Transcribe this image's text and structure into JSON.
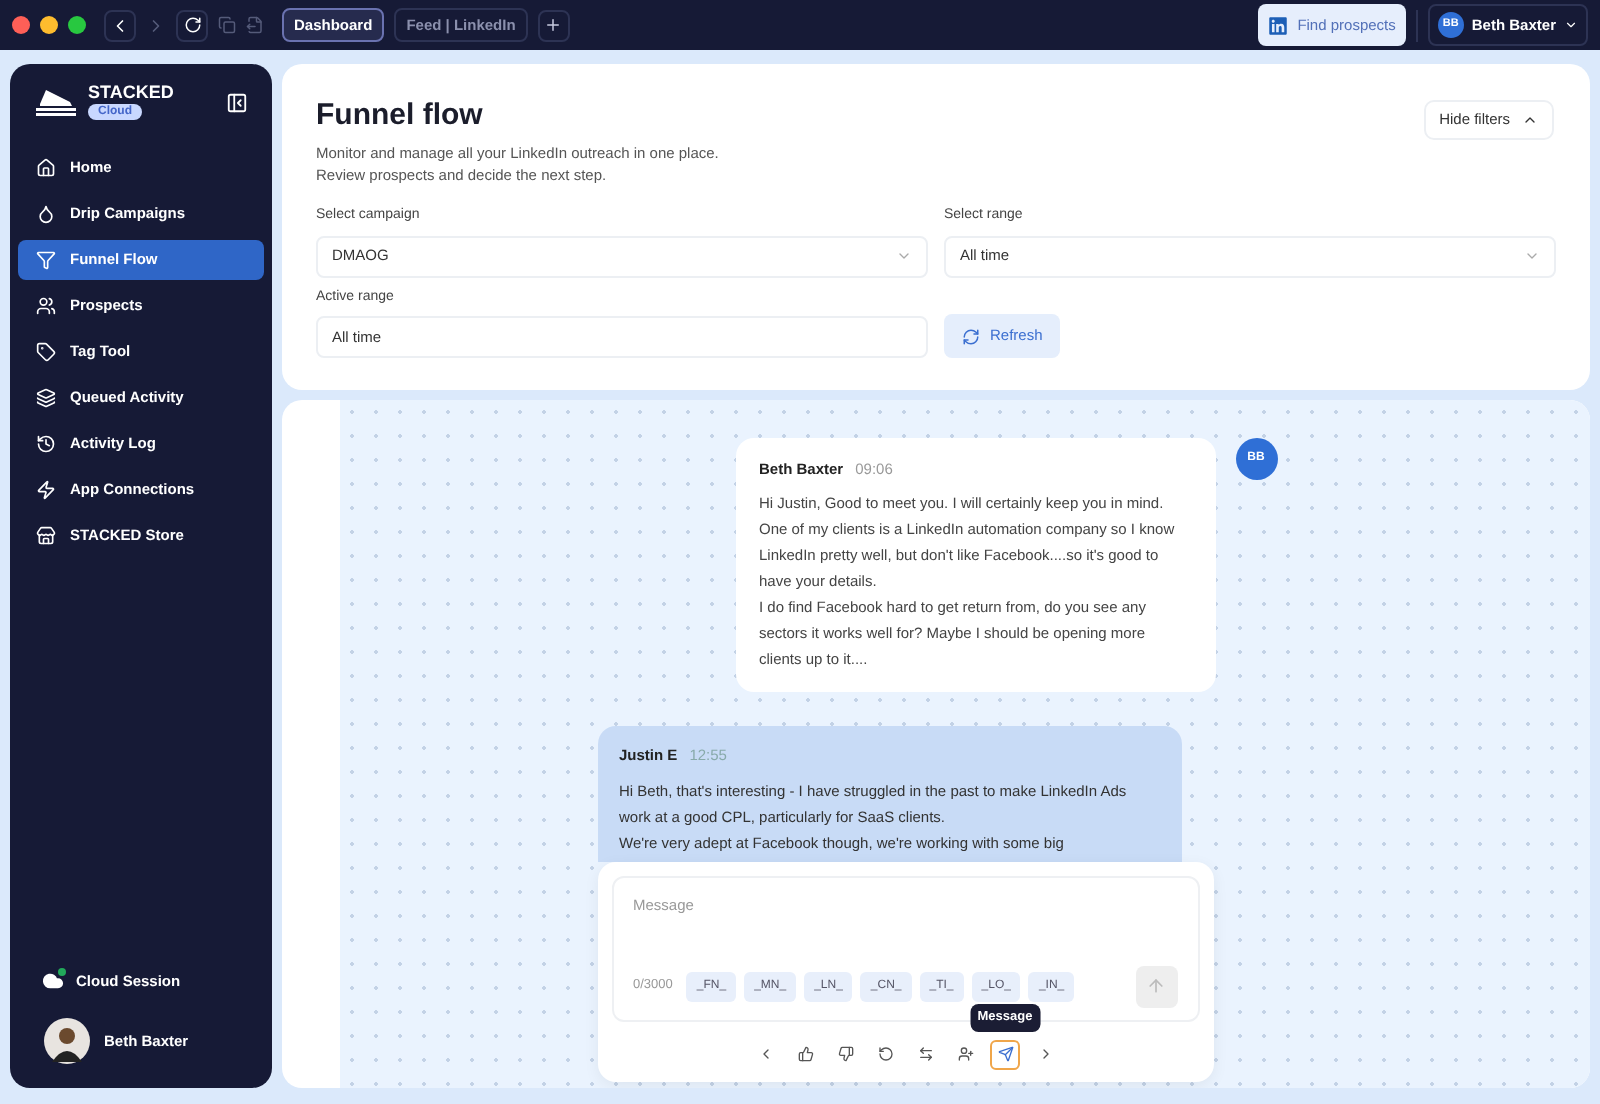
{
  "browser": {
    "tabs": [
      {
        "label": "Dashboard",
        "selected": true
      },
      {
        "label": "Feed | LinkedIn",
        "selected": false
      }
    ],
    "find_prospects": "Find prospects",
    "user_initials": "BB",
    "user_name": "Beth Baxter"
  },
  "sidebar": {
    "brand": "STACKED",
    "badge": "Cloud",
    "items": [
      {
        "label": "Home",
        "kind": "home",
        "selected": false
      },
      {
        "label": "Drip Campaigns",
        "kind": "drip",
        "selected": false
      },
      {
        "label": "Funnel Flow",
        "kind": "funnel",
        "selected": true
      },
      {
        "label": "Prospects",
        "kind": "users",
        "selected": false
      },
      {
        "label": "Tag Tool",
        "kind": "tag",
        "selected": false
      },
      {
        "label": "Queued Activity",
        "kind": "layers",
        "selected": false
      },
      {
        "label": "Activity Log",
        "kind": "history",
        "selected": false
      },
      {
        "label": "App Connections",
        "kind": "zap",
        "selected": false
      },
      {
        "label": "STACKED Store",
        "kind": "store",
        "selected": false
      }
    ],
    "session_label": "Cloud Session",
    "user_name": "Beth Baxter"
  },
  "header": {
    "title": "Funnel flow",
    "description": [
      "Monitor and manage all your LinkedIn outreach in one place.",
      "Review prospects and decide the next step."
    ],
    "hide_filters": "Hide filters",
    "filters": [
      {
        "label": "Select campaign",
        "value": "DMAOG",
        "kind": "select"
      },
      {
        "label": "Select range",
        "value": "All time",
        "kind": "select"
      },
      {
        "label": "Active range",
        "value": "All time",
        "kind": "text"
      }
    ],
    "refresh": "Refresh"
  },
  "chat": {
    "messages": [
      {
        "kind": "outgoing",
        "sender": "Beth Baxter",
        "time": "09:06",
        "initials": "BB",
        "paragraphs": [
          "Hi Justin, Good to meet you. I will certainly keep you in mind. One of my clients is a LinkedIn automation company so I know LinkedIn pretty well, but don't like Facebook....so it's good to have your details.",
          "I do find Facebook hard to get return from, do you see any sectors it works well for? Maybe I should be opening more clients up to it...."
        ]
      },
      {
        "kind": "incoming",
        "sender": "Justin E",
        "time": "12:55",
        "paragraphs": [
          "Hi Beth, that's interesting - I have struggled in the past to make LinkedIn Ads work at a good CPL, particularly for SaaS clients.",
          "We're very adept at Facebook though, we're working with some big"
        ]
      }
    ],
    "composer": {
      "placeholder": "Message",
      "counter": "0/3000",
      "tokens": [
        "_FN_",
        "_MN_",
        "_LN_",
        "_CN_",
        "_TI_",
        "_LO_",
        "_IN_"
      ],
      "tooltip": "Message",
      "actions": [
        {
          "kind": "prev",
          "selected": false
        },
        {
          "kind": "like",
          "selected": false
        },
        {
          "kind": "dislike",
          "selected": false
        },
        {
          "kind": "undo",
          "selected": false
        },
        {
          "kind": "swap",
          "selected": false
        },
        {
          "kind": "assign",
          "selected": false
        },
        {
          "kind": "send",
          "selected": true
        },
        {
          "kind": "next",
          "selected": false
        }
      ]
    }
  }
}
